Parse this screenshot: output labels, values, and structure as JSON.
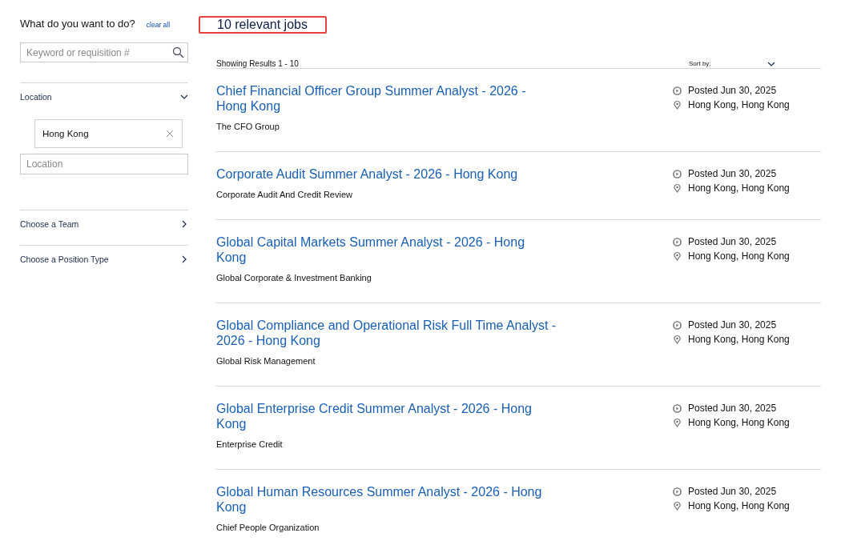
{
  "sidebar": {
    "heading": "What do you want to do?",
    "clear_all": "clear all",
    "search": {
      "placeholder": "Keyword or requisition #"
    },
    "location": {
      "label": "Location",
      "expanded": true,
      "chips": [
        "Hong Kong"
      ],
      "input": {
        "placeholder": "Location"
      }
    },
    "filters": [
      {
        "label": "Choose a Team",
        "expanded": false
      },
      {
        "label": "Choose a Position Type",
        "expanded": false
      }
    ]
  },
  "results": {
    "count_title": "10 relevant jobs",
    "highlighted": true,
    "showing": "Showing Results 1 - 10",
    "sort_label": "Sort by:",
    "jobs": [
      {
        "title": "Chief Financial Officer Group Summer Analyst - 2026 - Hong Kong",
        "team": "The CFO Group",
        "posted": "Posted Jun 30, 2025",
        "location": "Hong Kong, Hong Kong"
      },
      {
        "title": "Corporate Audit Summer Analyst - 2026 - Hong Kong",
        "team": "Corporate Audit And Credit Review",
        "posted": "Posted Jun 30, 2025",
        "location": "Hong Kong, Hong Kong"
      },
      {
        "title": "Global Capital Markets Summer Analyst - 2026 - Hong Kong",
        "team": "Global Corporate & Investment Banking",
        "posted": "Posted Jun 30, 2025",
        "location": "Hong Kong, Hong Kong"
      },
      {
        "title": "Global Compliance and Operational Risk Full Time Analyst - 2026 - Hong Kong",
        "team": "Global Risk Management",
        "posted": "Posted Jun 30, 2025",
        "location": "Hong Kong, Hong Kong"
      },
      {
        "title": "Global Enterprise Credit Summer Analyst - 2026 - Hong Kong",
        "team": "Enterprise Credit",
        "posted": "Posted Jun 30, 2025",
        "location": "Hong Kong, Hong Kong"
      },
      {
        "title": "Global Human Resources Summer Analyst - 2026 - Hong Kong",
        "team": "Chief People Organization",
        "posted": "Posted Jun 30, 2025",
        "location": "Hong Kong, Hong Kong"
      }
    ]
  }
}
